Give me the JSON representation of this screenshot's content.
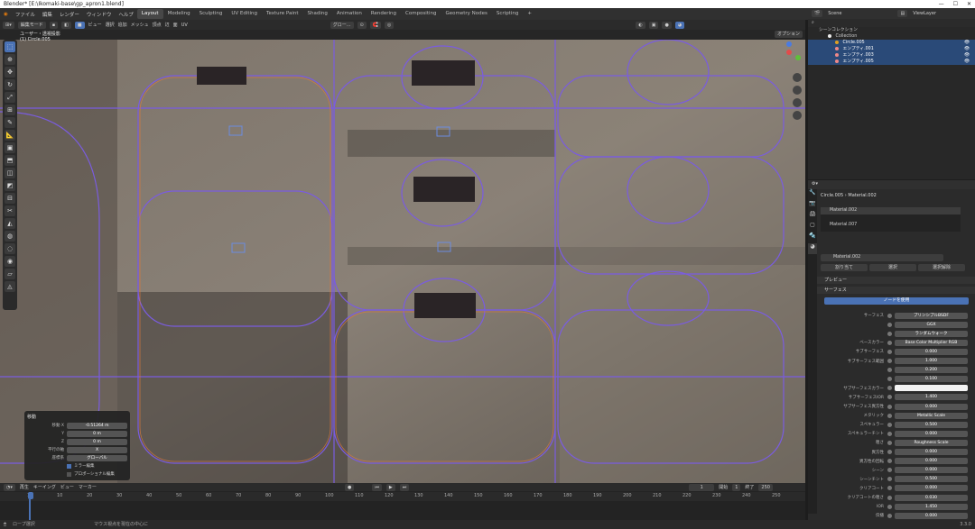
{
  "window": {
    "title": "Blender* [E:\\Ikomaki-base\\gp_apron1.blend]"
  },
  "menu": [
    "ファイル",
    "編集",
    "レンダー",
    "ウィンドウ",
    "ヘルプ"
  ],
  "workspaces": [
    "Layout",
    "Modeling",
    "Sculpting",
    "UV Editing",
    "Texture Paint",
    "Shading",
    "Animation",
    "Rendering",
    "Compositing",
    "Geometry Nodes",
    "Scripting",
    "+"
  ],
  "active_workspace": "Layout",
  "scene": {
    "label": "Scene",
    "view_layer": "ViewLayer"
  },
  "viewport_header": {
    "mode": "編集モード",
    "view": "ビュー",
    "select": "選択",
    "add": "追加",
    "mesh": "メッシュ",
    "vertex": "頂点",
    "edge": "辺",
    "face": "面",
    "uv": "UV",
    "transform": "グロー...",
    "options": "オプション"
  },
  "viewport_info": {
    "line1": "ユーザー・透視投影",
    "line2": "(1) Circle.005"
  },
  "operator_panel": {
    "title": "移動",
    "rows": [
      {
        "label": "移動 X",
        "value": "-0.51264 m"
      },
      {
        "label": "Y",
        "value": "0 m"
      },
      {
        "label": "Z",
        "value": "0 m"
      },
      {
        "label": "平行の軸",
        "value": "X"
      },
      {
        "label": "座標系",
        "value": "グローバル"
      }
    ],
    "check1": "ミラー編集",
    "check2": "プロポーショナル編集"
  },
  "timeline": {
    "menus": [
      "再生",
      "キーイング",
      "ビュー",
      "マーカー"
    ],
    "current": "1",
    "start_label": "開始",
    "start": "1",
    "end_label": "終了",
    "end": "250",
    "ticks": [
      "1",
      "10",
      "20",
      "30",
      "40",
      "50",
      "60",
      "70",
      "80",
      "90",
      "100",
      "110",
      "120",
      "130",
      "140",
      "150",
      "160",
      "170",
      "180",
      "190",
      "200",
      "210",
      "220",
      "230",
      "240",
      "250"
    ]
  },
  "statusbar": {
    "left": "ロープ選択",
    "middle": "マウス視点を現在の中心に",
    "version": "3.3.0"
  },
  "outliner": {
    "title": "シーンコレクション",
    "collection": "Collection",
    "items": [
      "Circle.005",
      "エンプティ.001",
      "エンプティ.003",
      "エンプティ.005"
    ]
  },
  "properties": {
    "breadcrumb_obj": "Circle.005",
    "breadcrumb_mat": "Material.002",
    "slots": [
      "Material.002",
      "",
      "Material.007"
    ],
    "material_name": "Material.002",
    "assign": "割り当て",
    "select": "選択",
    "deselect": "選択解除",
    "preview": "プレビュー",
    "surface_panel": "サーフェス",
    "use_nodes": "ノードを使用",
    "rows": [
      {
        "label": "サーフェス",
        "value": "プリンシプルBSDF"
      },
      {
        "label": "",
        "value": "GGX"
      },
      {
        "label": "",
        "value": "ランダムウォーク"
      },
      {
        "label": "ベースカラー",
        "value": "Base Color Multiplier RGB"
      },
      {
        "label": "サブサーフェス",
        "value": "0.000"
      },
      {
        "label": "サブサーフェス範囲",
        "value": "1.000"
      },
      {
        "label": "",
        "value": "0.200"
      },
      {
        "label": "",
        "value": "0.100"
      },
      {
        "label": "サブサーフェスカラー",
        "value": ""
      },
      {
        "label": "サブサーフェスIOR",
        "value": "1.400"
      },
      {
        "label": "サブサーフェス異方性",
        "value": "0.000"
      },
      {
        "label": "メタリック",
        "value": "Metallic Scale"
      },
      {
        "label": "スペキュラー",
        "value": "0.500"
      },
      {
        "label": "スペキュラーチント",
        "value": "0.000"
      },
      {
        "label": "粗さ",
        "value": "Roughness Scale"
      },
      {
        "label": "異方性",
        "value": "0.000"
      },
      {
        "label": "異方性の回転",
        "value": "0.000"
      },
      {
        "label": "シーン",
        "value": "0.000"
      },
      {
        "label": "シーンチント",
        "value": "0.500"
      },
      {
        "label": "クリアコート",
        "value": "0.000"
      },
      {
        "label": "クリアコートの粗さ",
        "value": "0.030"
      },
      {
        "label": "IOR",
        "value": "1.450"
      },
      {
        "label": "伝播",
        "value": "0.000"
      }
    ]
  },
  "colors": {
    "accent": "#4a72b5",
    "selection": "#2a4a78",
    "curve_purple": "#7a5ce0",
    "curve_orange": "#e07a3a"
  }
}
